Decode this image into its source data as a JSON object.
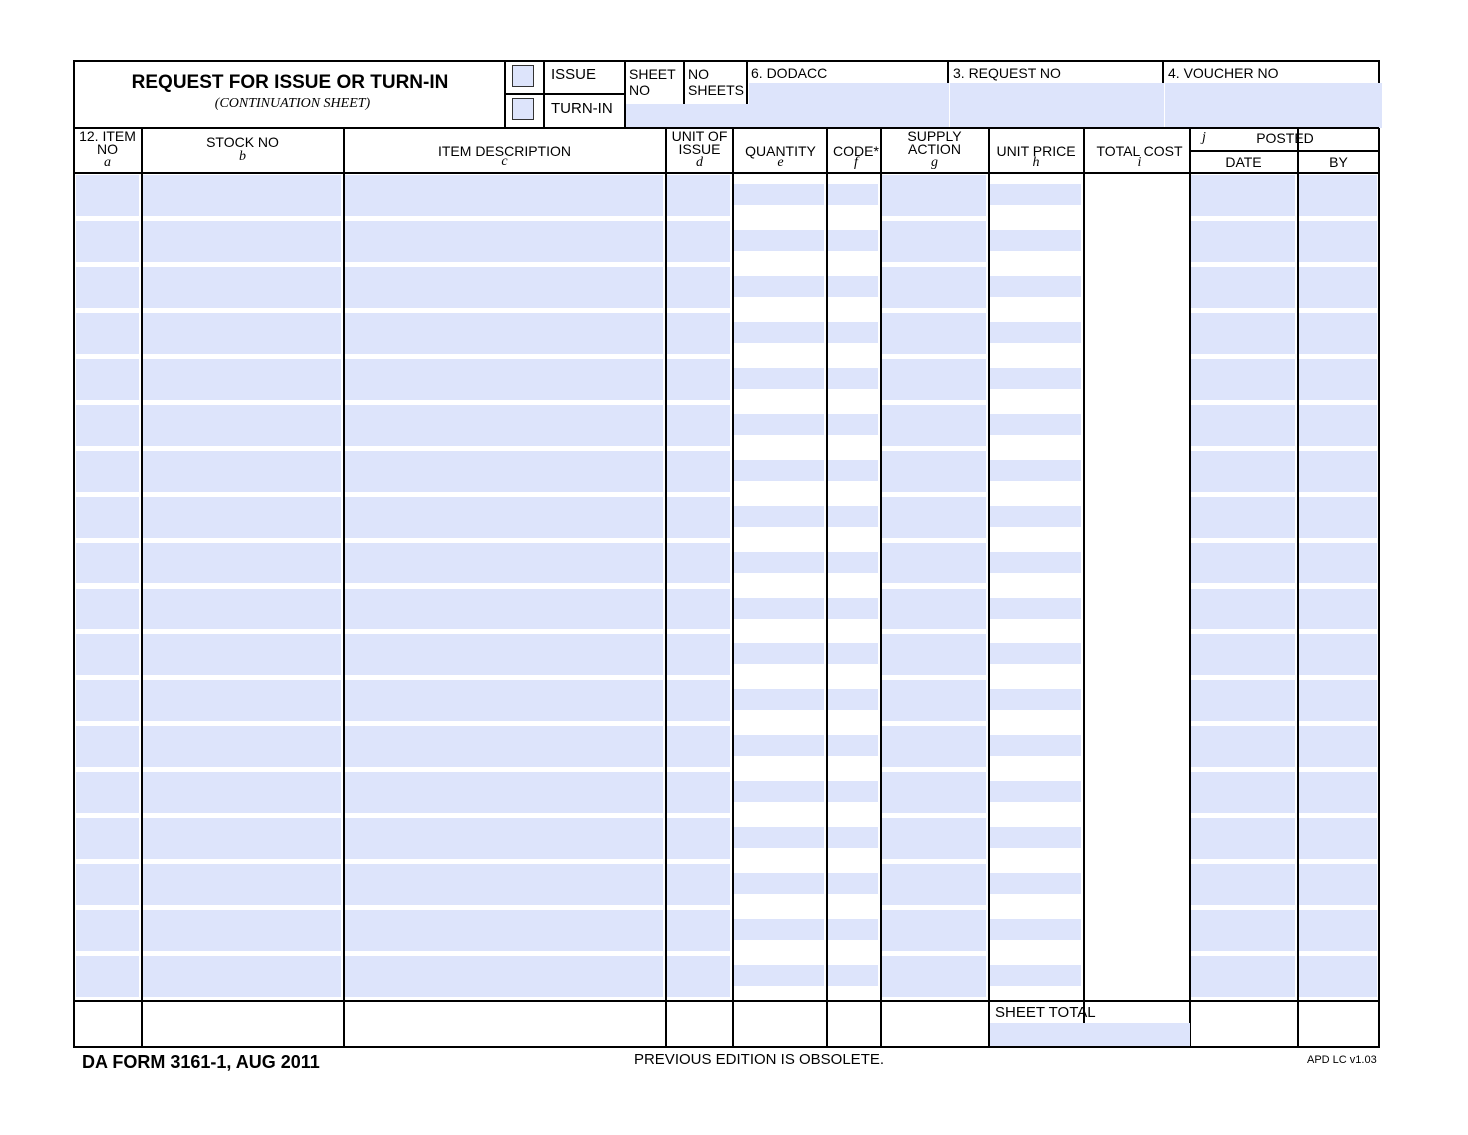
{
  "header": {
    "title": "REQUEST FOR ISSUE OR TURN-IN",
    "subtitle": "(CONTINUATION SHEET)",
    "issue_label": "ISSUE",
    "turnin_label": "TURN-IN",
    "sheet_no_label_1": "SHEET",
    "sheet_no_label_2": "NO",
    "no_sheets_label_1": "NO",
    "no_sheets_label_2": "SHEETS",
    "dodacc_label": "6. DODACC",
    "request_no_label": "3. REQUEST NO",
    "voucher_no_label": "4. VOUCHER NO"
  },
  "columns": {
    "item_no_1": "12. ITEM",
    "item_no_2": "NO",
    "item_no_letter": "a",
    "stock_no": "STOCK NO",
    "stock_no_letter": "b",
    "item_desc": "ITEM DESCRIPTION",
    "item_desc_letter": "c",
    "unit_issue_1": "UNIT OF",
    "unit_issue_2": "ISSUE",
    "unit_issue_letter": "d",
    "quantity": "QUANTITY",
    "quantity_letter": "e",
    "code": "CODE*",
    "code_letter": "f",
    "supply_action_1": "SUPPLY",
    "supply_action_2": "ACTION",
    "supply_action_letter": "g",
    "unit_price": "UNIT PRICE",
    "unit_price_letter": "h",
    "total_cost": "TOTAL COST",
    "total_cost_letter": "i",
    "posted_letter": "j",
    "posted": "POSTED",
    "date": "DATE",
    "by": "BY"
  },
  "footer": {
    "sheet_total": "SHEET TOTAL",
    "form_id": "DA FORM 3161-1, AUG 2011",
    "previous_edition": "PREVIOUS EDITION IS OBSOLETE.",
    "apd": "APD LC v1.03"
  }
}
